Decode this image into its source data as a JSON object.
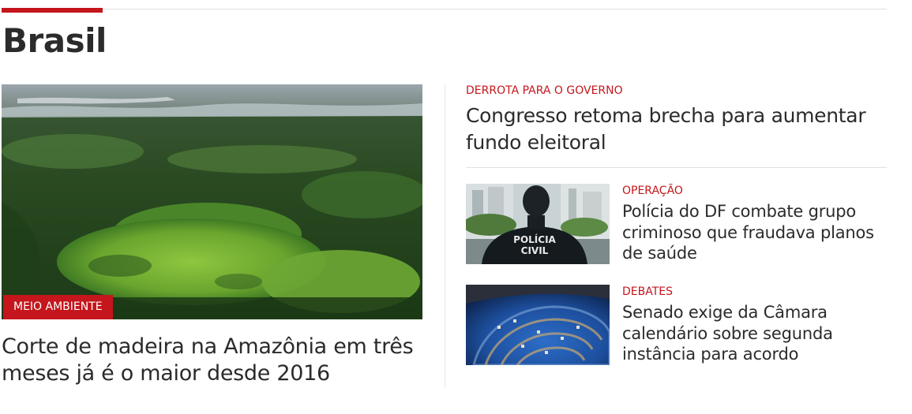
{
  "section": {
    "title": "Brasil"
  },
  "feature": {
    "tag": "MEIO AMBIENTE",
    "headline": "Corte de madeira na Amazônia em três meses já é o maior desde 2016",
    "image": "amazon-rainforest-aerial-photo"
  },
  "lead": {
    "kicker": "DERROTA PARA O GOVERNO",
    "headline": "Congresso retoma brecha para aumentar fundo eleitoral"
  },
  "stories": [
    {
      "kicker": "OPERAÇÃO",
      "headline": "Polícia do DF combate grupo criminoso que fraudava planos de saúde",
      "image": "police-officer-photo",
      "image_text_line1": "POLÍCIA",
      "image_text_line2": "CIVIL"
    },
    {
      "kicker": "DEBATES",
      "headline": "Senado exige da Câmara calendário sobre segunda instância para acordo",
      "image": "senate-plenary-photo"
    }
  ],
  "colors": {
    "accent": "#c4161c",
    "text": "#2b2b2b",
    "rule": "#e0e0e0"
  }
}
